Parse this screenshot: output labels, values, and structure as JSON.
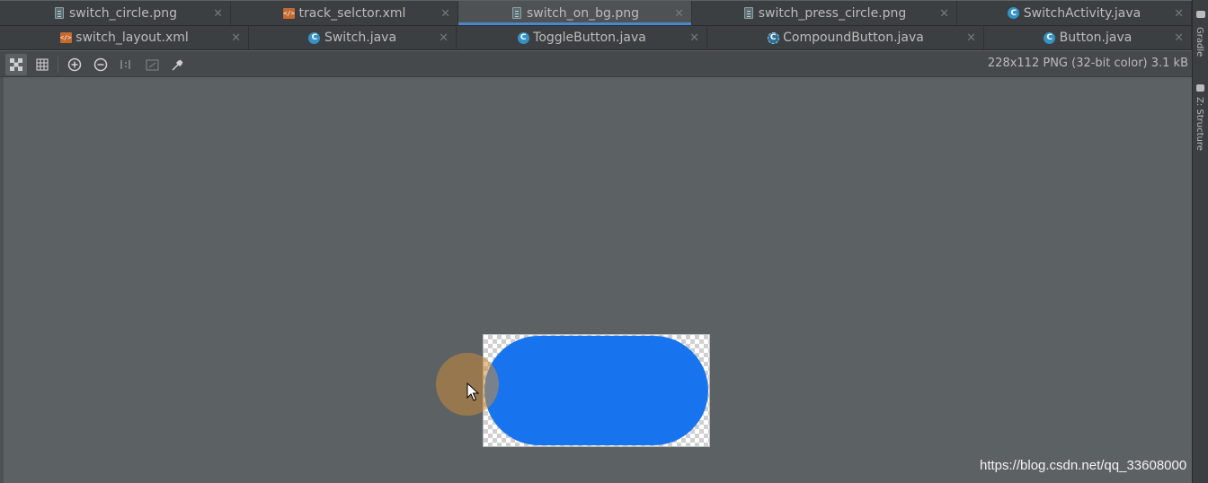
{
  "tabs_row1": [
    {
      "label": "switch_circle.png",
      "icon": "image-file-icon",
      "active": false
    },
    {
      "label": "track_selctor.xml",
      "icon": "xml-file-icon",
      "active": false
    },
    {
      "label": "switch_on_bg.png",
      "icon": "image-file-icon",
      "active": true
    },
    {
      "label": "switch_press_circle.png",
      "icon": "image-file-icon",
      "active": false
    },
    {
      "label": "SwitchActivity.java",
      "icon": "java-class-icon",
      "active": false
    }
  ],
  "tabs_row2": [
    {
      "label": "switch_layout.xml",
      "icon": "xml-file-icon",
      "active": false
    },
    {
      "label": "Switch.java",
      "icon": "java-class-icon",
      "active": false
    },
    {
      "label": "ToggleButton.java",
      "icon": "java-class-icon",
      "active": false
    },
    {
      "label": "CompoundButton.java",
      "icon": "abstract-class-icon",
      "active": false
    },
    {
      "label": "Button.java",
      "icon": "java-class-icon",
      "active": false
    }
  ],
  "close_glyph": "×",
  "toolbar": {
    "buttons": [
      "chessboard-icon",
      "grid-icon",
      "zoom-in-icon",
      "zoom-out-icon",
      "actual-size-icon",
      "fit-zoom-icon",
      "color-picker-icon"
    ],
    "image_info": "228x112 PNG (32-bit color) 3.1 kB"
  },
  "right_strip": {
    "gradle_label": "Gradle",
    "structure_label": "Z: Structure"
  },
  "image": {
    "fill_color": "#1774ee"
  },
  "watermark": "https://blog.csdn.net/qq_33608000"
}
